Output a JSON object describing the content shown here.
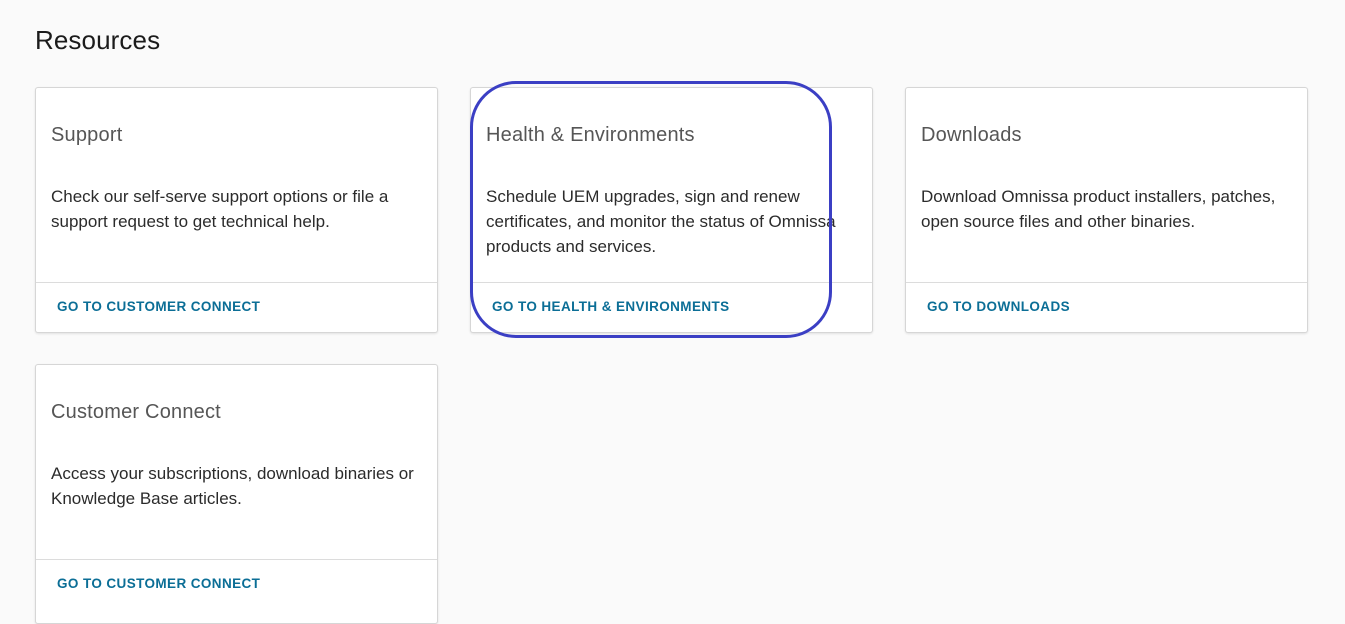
{
  "page": {
    "title": "Resources"
  },
  "cards": [
    {
      "title": "Support",
      "description": "Check our self-serve support options or file a support request to get technical help.",
      "link_label": "GO TO CUSTOMER CONNECT"
    },
    {
      "title": "Health & Environments",
      "description": "Schedule UEM upgrades, sign and renew certificates, and monitor the status of Omnissa products and services.",
      "link_label": "GO TO HEALTH & ENVIRONMENTS"
    },
    {
      "title": "Downloads",
      "description": "Download Omnissa product installers, patches, open source files and other binaries.",
      "link_label": "GO TO DOWNLOADS"
    },
    {
      "title": "Customer Connect",
      "description": "Access your subscriptions, download binaries or Knowledge Base articles.",
      "link_label": "GO TO CUSTOMER CONNECT"
    }
  ],
  "colors": {
    "link": "#0b6e96",
    "highlight": "#3b3fc4",
    "background": "#fafafa"
  }
}
